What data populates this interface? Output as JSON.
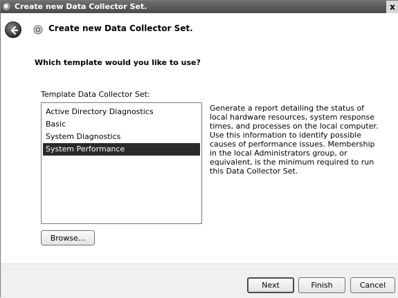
{
  "window": {
    "title": "Create new Data Collector Set.",
    "close_glyph": "x"
  },
  "header": {
    "title": "Create new Data Collector Set."
  },
  "main": {
    "question": "Which template would you like to use?",
    "list_label": "Template Data Collector Set:",
    "templates": [
      "Active Directory Diagnostics",
      "Basic",
      "System Diagnostics",
      "System Performance"
    ],
    "selected_template": "System Performance",
    "description": "Generate a report detailing the status of local hardware resources, system response times, and processes on the local computer. Use this information to identify possible causes of performance issues. Membership in the local Administrators group, or equivalent, is the minimum required to run this Data Collector Set.",
    "browse_label": "Browse..."
  },
  "footer": {
    "next_label": "Next",
    "finish_label": "Finish",
    "cancel_label": "Cancel"
  },
  "icons": {
    "window_icon": "data-collector-icon",
    "back": "back-arrow-icon",
    "header_icon": "data-collector-icon",
    "close": "close-icon"
  }
}
